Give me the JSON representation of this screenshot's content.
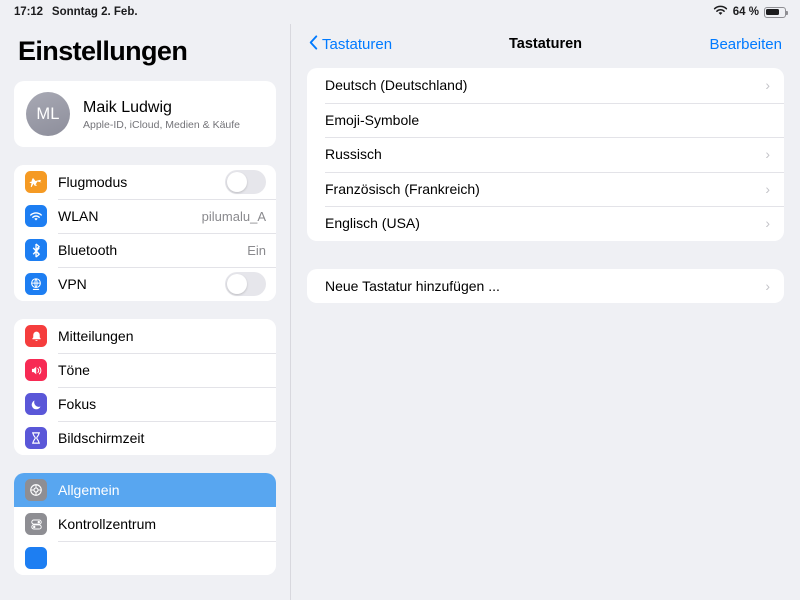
{
  "statusbar": {
    "time": "17:12",
    "date": "Sonntag 2. Feb.",
    "wifi_icon": "wifi-icon",
    "battery_percent": "64 %",
    "battery_icon": "battery-icon"
  },
  "sidebar": {
    "title": "Einstellungen",
    "profile": {
      "initials": "ML",
      "name": "Maik Ludwig",
      "subtitle": "Apple-ID, iCloud, Medien & Käufe"
    },
    "groups": [
      {
        "items": [
          {
            "label": "Flugmodus",
            "icon": "airplane-icon",
            "color": "#f59a23",
            "control": "toggle",
            "toggle_on": false
          },
          {
            "label": "WLAN",
            "icon": "wifi-icon",
            "color": "#1d7ef2",
            "control": "value",
            "value": "pilumalu_A"
          },
          {
            "label": "Bluetooth",
            "icon": "bluetooth-icon",
            "color": "#1d7ef2",
            "control": "value",
            "value": "Ein"
          },
          {
            "label": "VPN",
            "icon": "vpn-globe-icon",
            "color": "#1d7ef2",
            "control": "toggle",
            "toggle_on": false
          }
        ]
      },
      {
        "items": [
          {
            "label": "Mitteilungen",
            "icon": "bell-icon",
            "color": "#f53d3d",
            "control": "none"
          },
          {
            "label": "Töne",
            "icon": "speaker-icon",
            "color": "#f72a54",
            "control": "none"
          },
          {
            "label": "Fokus",
            "icon": "moon-icon",
            "color": "#5a57d8",
            "control": "none"
          },
          {
            "label": "Bildschirmzeit",
            "icon": "hourglass-icon",
            "color": "#5a57d8",
            "control": "none"
          }
        ]
      },
      {
        "items": [
          {
            "label": "Allgemein",
            "icon": "gear-icon",
            "color": "#8e8e93",
            "control": "none",
            "selected": true
          },
          {
            "label": "Kontrollzentrum",
            "icon": "control-center-icon",
            "color": "#8e8e93",
            "control": "none"
          },
          {
            "label": "",
            "icon": "partial-icon",
            "color": "#1d7ef2",
            "control": "none"
          }
        ]
      }
    ],
    "selected_accent": "#58a6f0"
  },
  "detail": {
    "nav": {
      "back_label": "Tastaturen",
      "back_icon": "chevron-left-icon",
      "title": "Tastaturen",
      "edit_label": "Bearbeiten"
    },
    "keyboards": [
      {
        "label": "Deutsch (Deutschland)",
        "chevron": true
      },
      {
        "label": "Emoji-Symbole",
        "chevron": false
      },
      {
        "label": "Russisch",
        "chevron": true
      },
      {
        "label": "Französisch (Frankreich)",
        "chevron": true
      },
      {
        "label": "Englisch (USA)",
        "chevron": true
      }
    ],
    "add_keyboard": {
      "label": "Neue Tastatur hinzufügen ...",
      "chevron": true
    }
  }
}
